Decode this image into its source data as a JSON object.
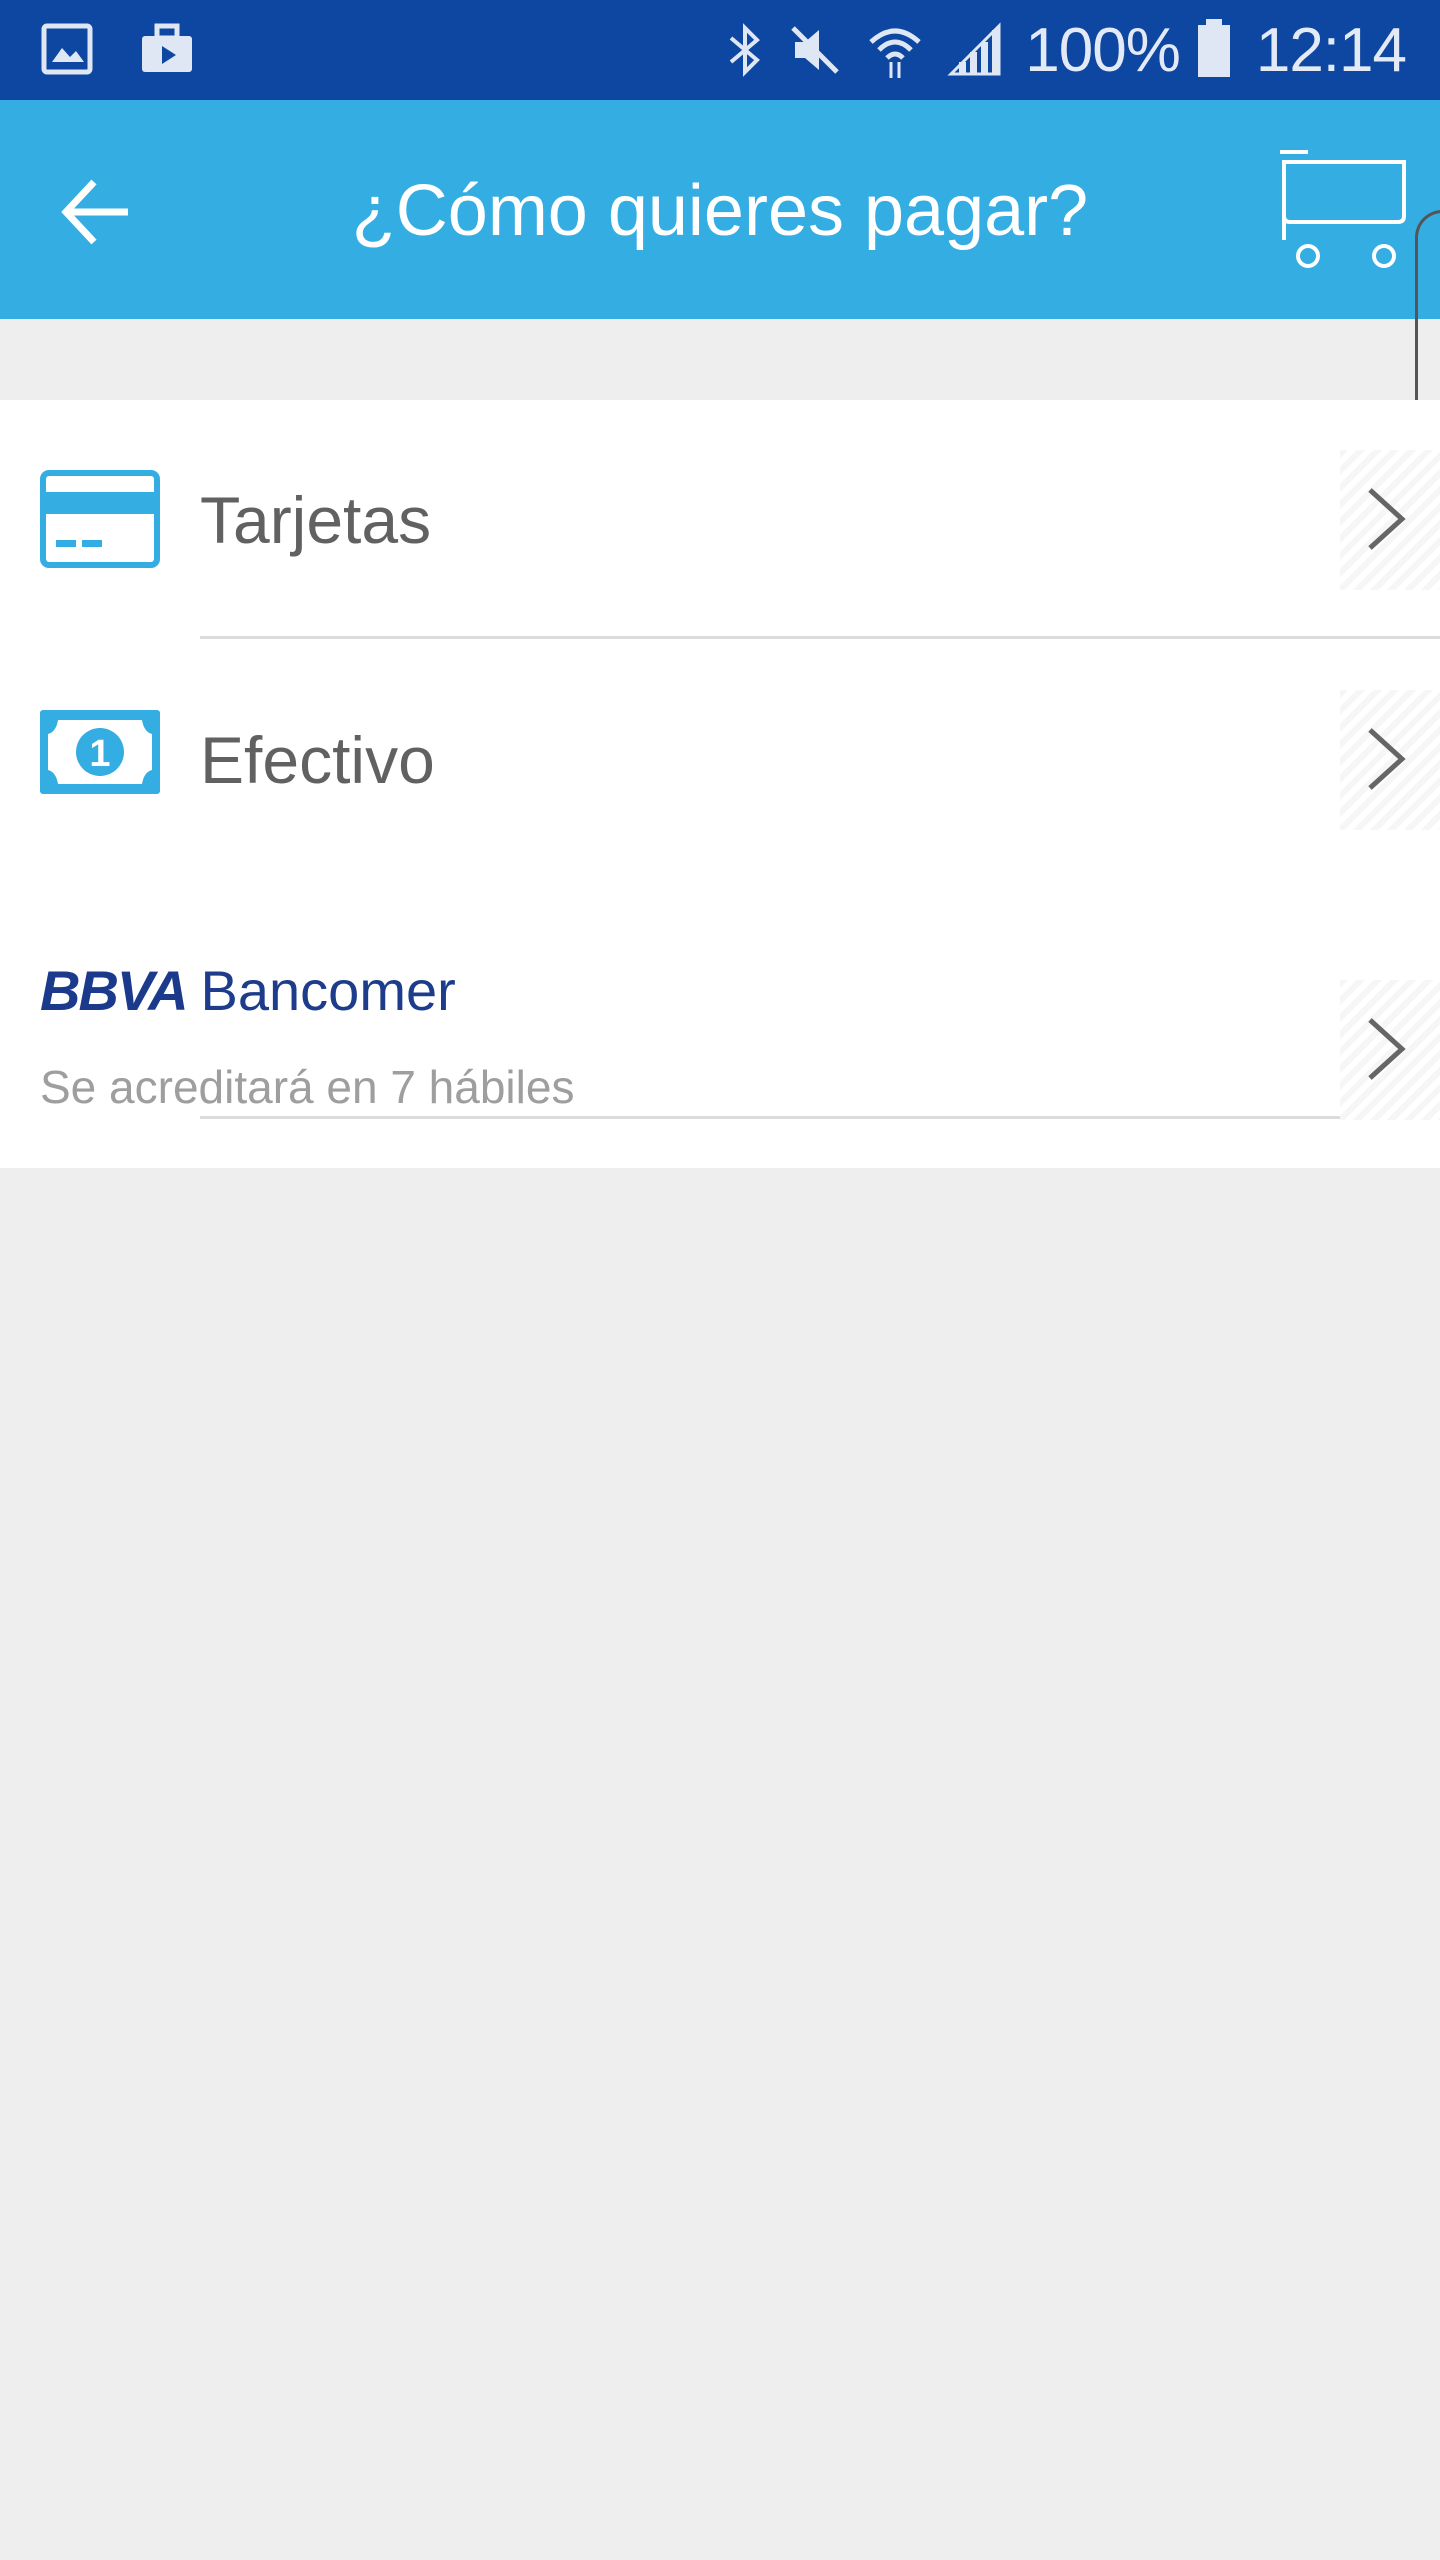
{
  "status_bar": {
    "battery_percent": "100%",
    "clock": "12:14",
    "icons": [
      "gallery-icon",
      "briefcase-icon",
      "bluetooth-icon",
      "mute-icon",
      "wifi-icon",
      "signal-icon",
      "battery-icon"
    ]
  },
  "app_bar": {
    "title": "¿Cómo quieres pagar?",
    "back_icon": "arrow-left-icon",
    "cart_icon": "cart-icon",
    "background_color": "#33ade2"
  },
  "payment_options": [
    {
      "label": "Tarjetas",
      "icon": "credit-card-icon"
    },
    {
      "label": "Efectivo",
      "icon": "cash-icon"
    },
    {
      "logo_mark": "BBVA",
      "logo_name": "Bancomer",
      "subtitle": "Se acreditará en 7 hábiles"
    }
  ],
  "colors": {
    "status_bar": "#0d47a1",
    "accent": "#33ade2",
    "label_text": "#616161",
    "subtitle_text": "#9e9e9e",
    "bbva_blue": "#1d3c8c",
    "background": "#eeeeee"
  }
}
